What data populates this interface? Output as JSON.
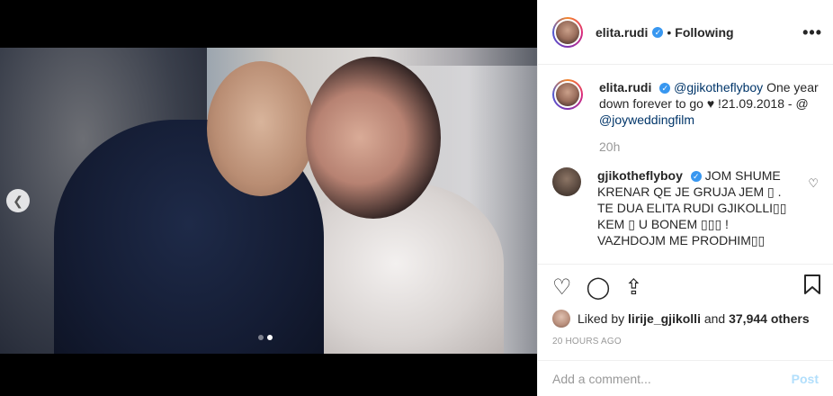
{
  "post": {
    "author": "elita.rudi",
    "following_label": "Following",
    "more_label": "•••",
    "caption_mention_1": "@gjikotheflyboy",
    "caption_text": "One year down forever to go ♥ !21.09.2018 - @",
    "caption_mention_2": "@joyweddingfilm",
    "time_ago": "20h",
    "carousel": {
      "total": 2,
      "active": 2
    }
  },
  "comment": {
    "author": "gjikotheflyboy",
    "text": "JOM SHUME KRENAR QE JE GRUJA JEM ▯ . TE DUA ELITA RUDI GJIKOLLI▯▯ KEM ▯ U BONEM ▯▯▯ ! VAZHDOJM ME PRODHIM▯▯"
  },
  "likes": {
    "prefix": "Liked by",
    "user": "lirije_gjikolli",
    "suffix": "and",
    "others": "37,944 others"
  },
  "posted_label": "20 HOURS AGO",
  "add_comment": {
    "placeholder": "Add a comment...",
    "post_label": "Post"
  },
  "icons": {
    "verified": "verified-icon",
    "heart": "heart-icon",
    "comment": "comment-icon",
    "share": "share-icon",
    "save": "bookmark-icon",
    "prev": "chevron-left-icon"
  },
  "colors": {
    "verified": "#3897f0",
    "link": "#003569",
    "post_disabled": "#b2dffc"
  }
}
